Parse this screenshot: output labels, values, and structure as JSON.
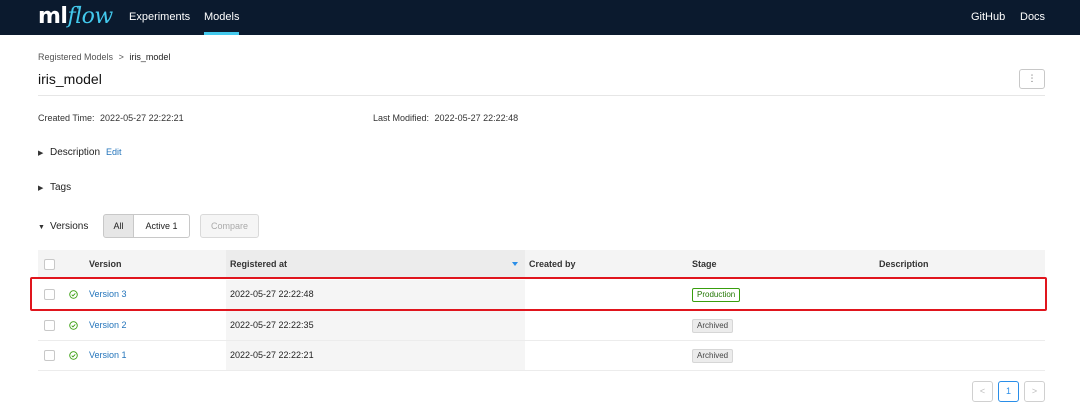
{
  "header": {
    "logo_ml": "ml",
    "logo_flow": "flow",
    "nav": [
      "Experiments",
      "Models"
    ],
    "right_nav": [
      "GitHub",
      "Docs"
    ]
  },
  "breadcrumb": {
    "parent": "Registered Models",
    "separator": ">",
    "current": "iris_model"
  },
  "page": {
    "title": "iris_model",
    "created_label": "Created Time:",
    "created_value": "2022-05-27 22:22:21",
    "modified_label": "Last Modified:",
    "modified_value": "2022-05-27 22:22:48"
  },
  "sections": {
    "description": "Description",
    "edit": "Edit",
    "tags": "Tags",
    "versions": "Versions"
  },
  "version_filter": {
    "all": "All",
    "active": "Active 1",
    "compare": "Compare"
  },
  "table": {
    "columns": [
      "Version",
      "Registered at",
      "Created by",
      "Stage",
      "Description"
    ],
    "rows": [
      {
        "version": "Version 3",
        "registered_at": "2022-05-27 22:22:48",
        "created_by": "",
        "stage": "Production",
        "description": ""
      },
      {
        "version": "Version 2",
        "registered_at": "2022-05-27 22:22:35",
        "created_by": "",
        "stage": "Archived",
        "description": ""
      },
      {
        "version": "Version 1",
        "registered_at": "2022-05-27 22:22:21",
        "created_by": "",
        "stage": "Archived",
        "description": ""
      }
    ]
  },
  "pagination": {
    "prev": "<",
    "current": "1",
    "next": ">"
  },
  "icons": {
    "more": "more-vertical-icon",
    "caret_collapsed": "caret-right-icon",
    "caret_expanded": "caret-down-icon",
    "status_ready": "check-circle-icon",
    "sort": "sort-descending-icon"
  },
  "colors": {
    "header_bg": "#0b1a2e",
    "accent": "#43c9ed",
    "link": "#2374bb",
    "production": "#389e0d",
    "highlight": "#e0151d"
  }
}
